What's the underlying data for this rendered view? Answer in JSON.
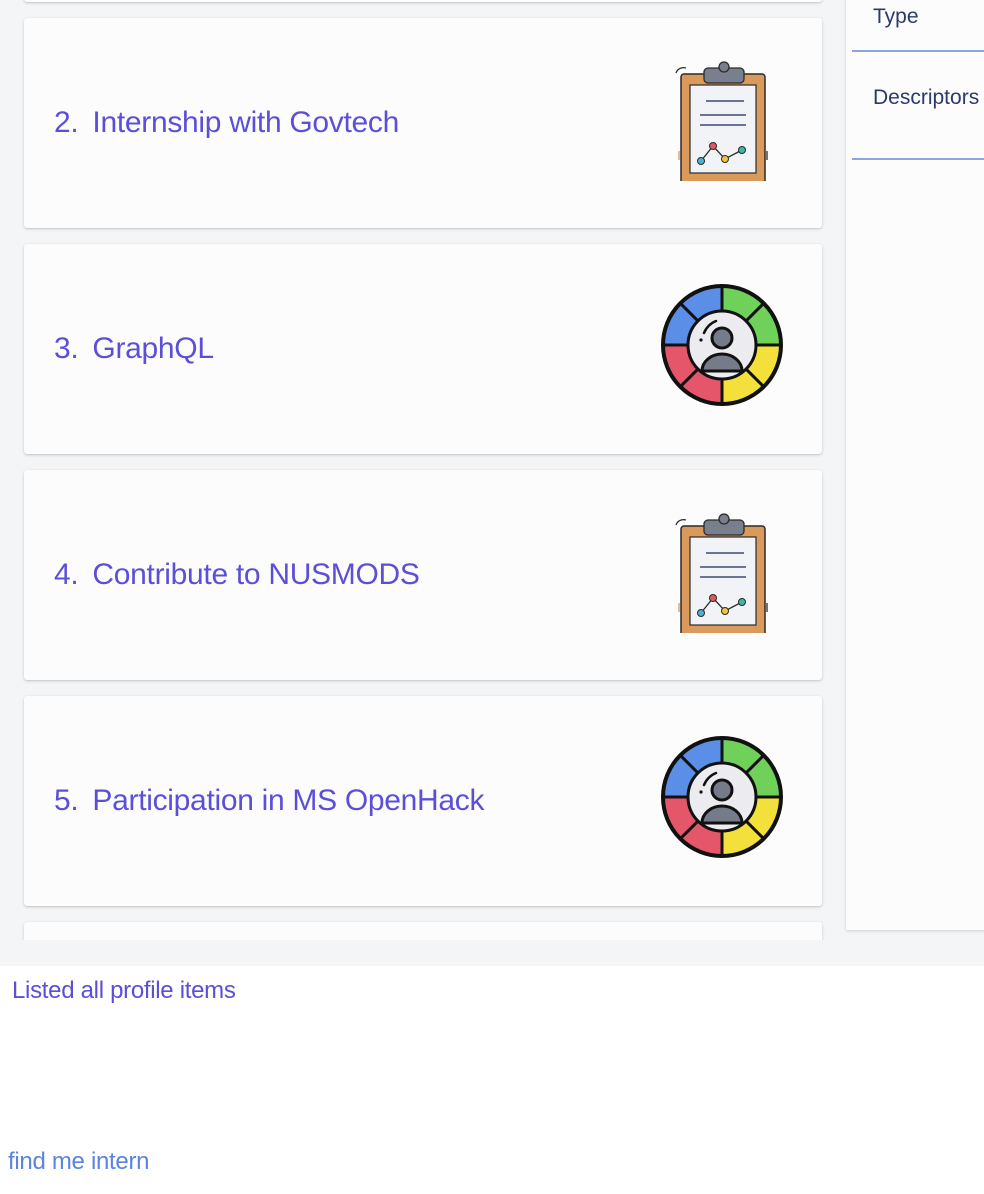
{
  "profile_list": {
    "items": [
      {
        "number": "2.",
        "title": "Internship with Govtech",
        "icon": "clipboard-chart-icon"
      },
      {
        "number": "3.",
        "title": "GraphQL",
        "icon": "user-color-wheel-icon"
      },
      {
        "number": "4.",
        "title": "Contribute to NUSMODS",
        "icon": "clipboard-chart-icon"
      },
      {
        "number": "5.",
        "title": "Participation in MS OpenHack",
        "icon": "user-color-wheel-icon"
      }
    ]
  },
  "detail_panel": {
    "type_label": "Type",
    "descriptors_label": "Descriptors"
  },
  "result_display": {
    "text": "Listed all profile items"
  },
  "command_box": {
    "value": "find me intern"
  },
  "colors": {
    "accent_text": "#5b4fd8",
    "command_text": "#5a84e0",
    "label_text": "#2a3a6b",
    "divider": "#8aa6dd",
    "background": "#f4f5f7",
    "card_background": "#fcfcfd"
  }
}
